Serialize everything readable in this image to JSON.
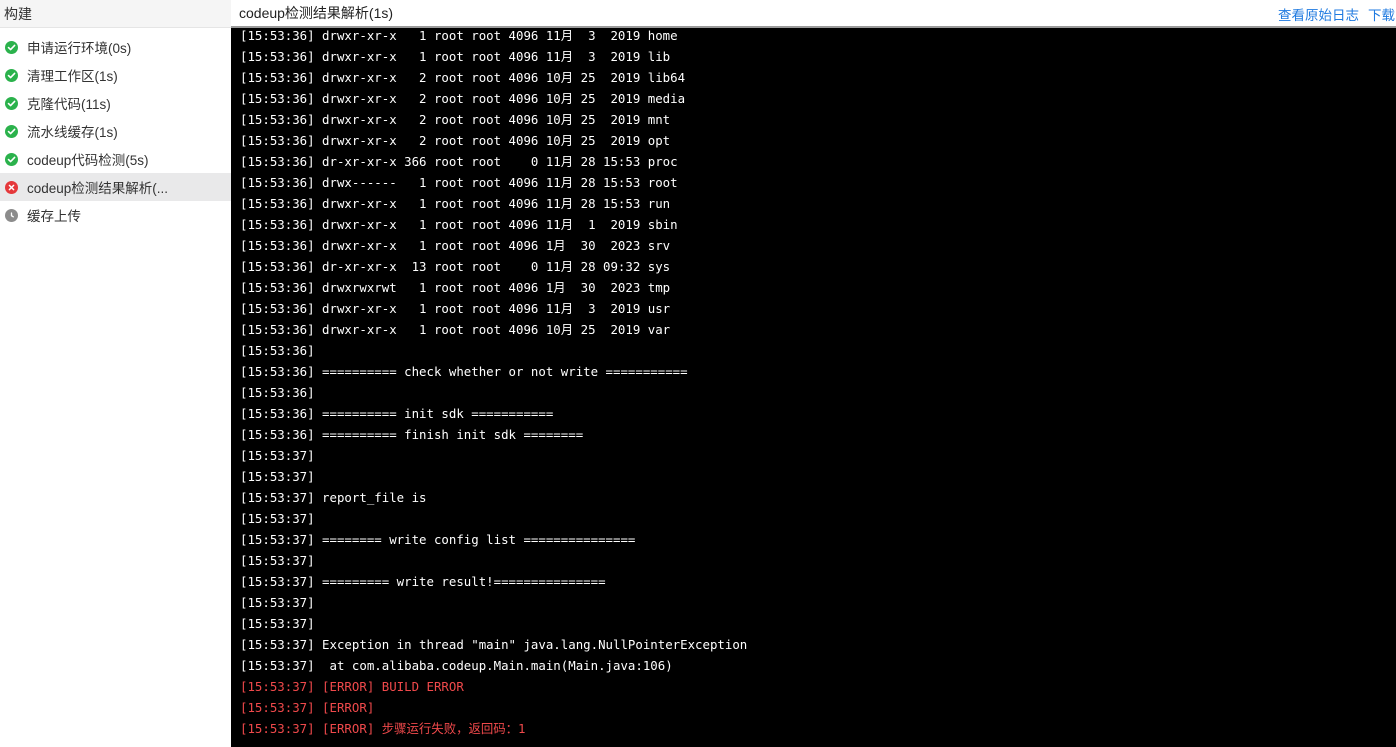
{
  "sidebar": {
    "title": "构建",
    "steps": [
      {
        "label": "申请运行环境(0s)",
        "status": "success"
      },
      {
        "label": "清理工作区(1s)",
        "status": "success"
      },
      {
        "label": "克隆代码(11s)",
        "status": "success"
      },
      {
        "label": "流水线缓存(1s)",
        "status": "success"
      },
      {
        "label": "codeup代码检测(5s)",
        "status": "success"
      },
      {
        "label": "codeup检测结果解析(...",
        "status": "failed"
      },
      {
        "label": "缓存上传",
        "status": "pending"
      }
    ]
  },
  "main": {
    "title": "codeup检测结果解析(1s)",
    "view_raw_log": "查看原始日志",
    "download": "下载"
  },
  "colors": {
    "success": "#2bb24c",
    "failed": "#e5383b",
    "pending": "#8c8c8c",
    "link": "#1f7ae0",
    "error_text": "#f0494b"
  },
  "log": {
    "lines": [
      {
        "text": "[15:53:36] drwxr-xr-x   1 root root 4096 11月  3  2019 home",
        "error": false
      },
      {
        "text": "[15:53:36] drwxr-xr-x   1 root root 4096 11月  3  2019 lib",
        "error": false
      },
      {
        "text": "[15:53:36] drwxr-xr-x   2 root root 4096 10月 25  2019 lib64",
        "error": false
      },
      {
        "text": "[15:53:36] drwxr-xr-x   2 root root 4096 10月 25  2019 media",
        "error": false
      },
      {
        "text": "[15:53:36] drwxr-xr-x   2 root root 4096 10月 25  2019 mnt",
        "error": false
      },
      {
        "text": "[15:53:36] drwxr-xr-x   2 root root 4096 10月 25  2019 opt",
        "error": false
      },
      {
        "text": "[15:53:36] dr-xr-xr-x 366 root root    0 11月 28 15:53 proc",
        "error": false
      },
      {
        "text": "[15:53:36] drwx------   1 root root 4096 11月 28 15:53 root",
        "error": false
      },
      {
        "text": "[15:53:36] drwxr-xr-x   1 root root 4096 11月 28 15:53 run",
        "error": false
      },
      {
        "text": "[15:53:36] drwxr-xr-x   1 root root 4096 11月  1  2019 sbin",
        "error": false
      },
      {
        "text": "[15:53:36] drwxr-xr-x   1 root root 4096 1月  30  2023 srv",
        "error": false
      },
      {
        "text": "[15:53:36] dr-xr-xr-x  13 root root    0 11月 28 09:32 sys",
        "error": false
      },
      {
        "text": "[15:53:36] drwxrwxrwt   1 root root 4096 1月  30  2023 tmp",
        "error": false
      },
      {
        "text": "[15:53:36] drwxr-xr-x   1 root root 4096 11月  3  2019 usr",
        "error": false
      },
      {
        "text": "[15:53:36] drwxr-xr-x   1 root root 4096 10月 25  2019 var",
        "error": false
      },
      {
        "text": "[15:53:36]",
        "error": false
      },
      {
        "text": "[15:53:36] ========== check whether or not write ===========",
        "error": false
      },
      {
        "text": "[15:53:36]",
        "error": false
      },
      {
        "text": "[15:53:36] ========== init sdk ===========",
        "error": false
      },
      {
        "text": "[15:53:36] ========== finish init sdk ========",
        "error": false
      },
      {
        "text": "[15:53:37]",
        "error": false
      },
      {
        "text": "[15:53:37]",
        "error": false
      },
      {
        "text": "[15:53:37] report_file is",
        "error": false
      },
      {
        "text": "[15:53:37]",
        "error": false
      },
      {
        "text": "[15:53:37] ======== write config list ===============",
        "error": false
      },
      {
        "text": "[15:53:37]",
        "error": false
      },
      {
        "text": "[15:53:37] ========= write result!===============",
        "error": false
      },
      {
        "text": "[15:53:37]",
        "error": false
      },
      {
        "text": "[15:53:37]",
        "error": false
      },
      {
        "text": "[15:53:37] Exception in thread \"main\" java.lang.NullPointerException",
        "error": false
      },
      {
        "text": "[15:53:37]  at com.alibaba.codeup.Main.main(Main.java:106)",
        "error": false
      },
      {
        "text": "[15:53:37] [ERROR] BUILD ERROR",
        "error": true
      },
      {
        "text": "[15:53:37] [ERROR]",
        "error": true
      },
      {
        "text": "[15:53:37] [ERROR] 步骤运行失败，返回码：1",
        "error": true
      }
    ]
  }
}
